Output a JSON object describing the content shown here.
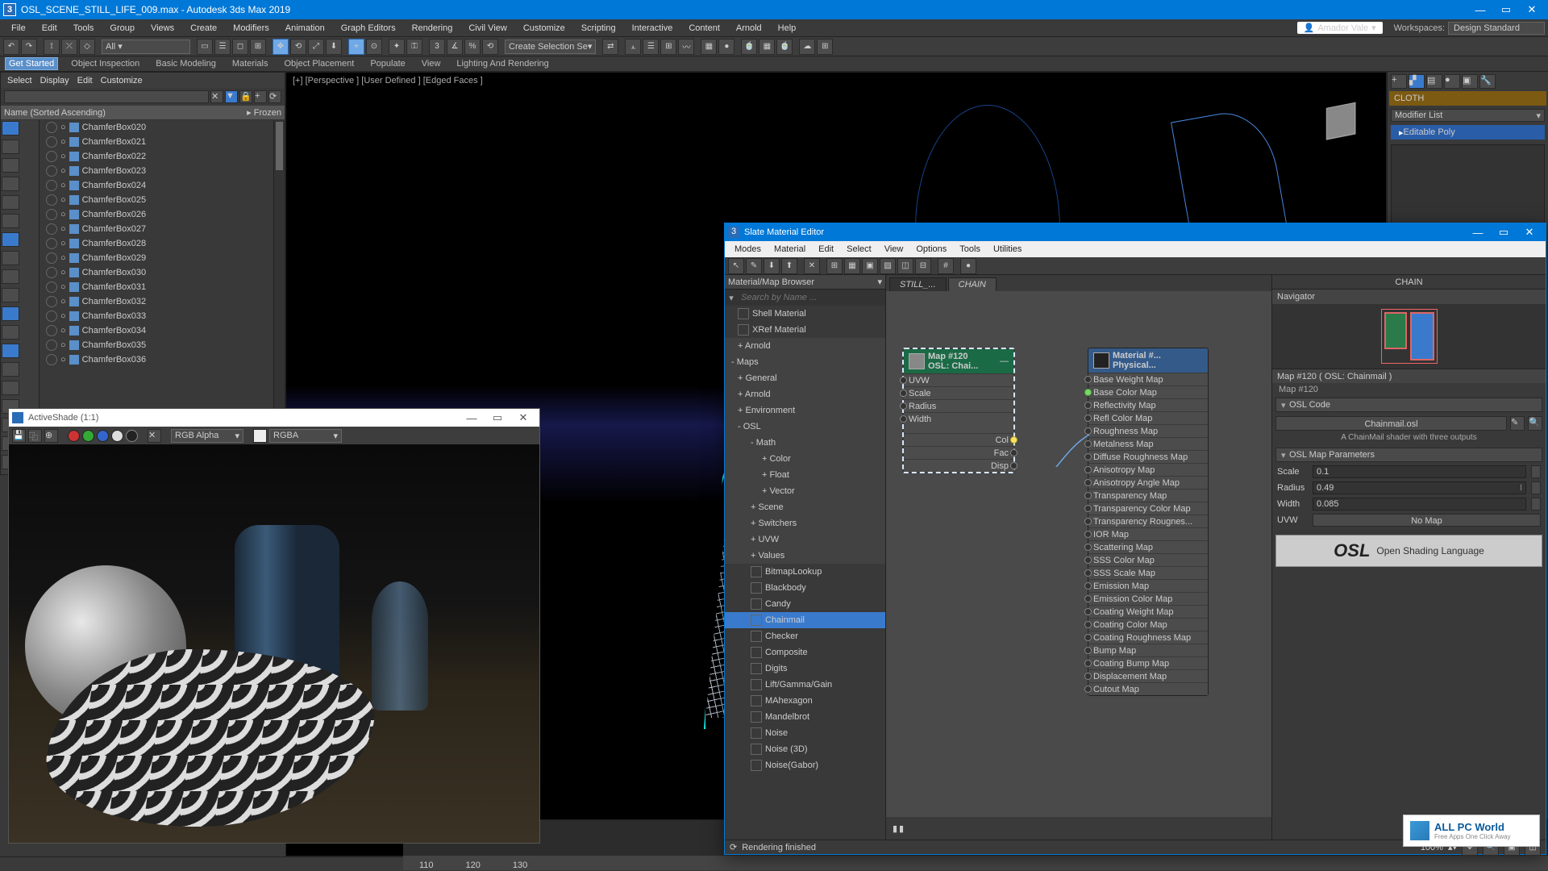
{
  "app": {
    "title": "OSL_SCENE_STILL_LIFE_009.max - Autodesk 3ds Max 2019",
    "user": "Amador Vale",
    "workspace_label": "Workspaces:",
    "workspace_value": "Design Standard"
  },
  "menus": [
    "File",
    "Edit",
    "Tools",
    "Group",
    "Views",
    "Create",
    "Modifiers",
    "Animation",
    "Graph Editors",
    "Rendering",
    "Civil View",
    "Customize",
    "Scripting",
    "Interactive",
    "Content",
    "Arnold",
    "Help"
  ],
  "selection_dropdown": "Create Selection Se",
  "ribbon": [
    "Get Started",
    "Object Inspection",
    "Basic Modeling",
    "Materials",
    "Object Placement",
    "Populate",
    "View",
    "Lighting And Rendering"
  ],
  "scene_explorer": {
    "menus": [
      "Select",
      "Display",
      "Edit",
      "Customize"
    ],
    "header_name": "Name (Sorted Ascending)",
    "header_frozen": "Frozen",
    "items": [
      "ChamferBox020",
      "ChamferBox021",
      "ChamferBox022",
      "ChamferBox023",
      "ChamferBox024",
      "ChamferBox025",
      "ChamferBox026",
      "ChamferBox027",
      "ChamferBox028",
      "ChamferBox029",
      "ChamferBox030",
      "ChamferBox031",
      "ChamferBox032",
      "ChamferBox033",
      "ChamferBox034",
      "ChamferBox035",
      "ChamferBox036"
    ]
  },
  "activeshade": {
    "title": "ActiveShade (1:1)",
    "channel": "RGB Alpha",
    "display": "RGBA"
  },
  "viewport": {
    "label": "[+] [Perspective ] [User Defined ] [Edged Faces ]"
  },
  "timeline": {
    "ticks": [
      "110",
      "120",
      "130"
    ]
  },
  "command_panel": {
    "stack_title": "CLOTH",
    "modlist": "Modifier List",
    "modifier": "Editable Poly"
  },
  "slate": {
    "title": "Slate Material Editor",
    "menus": [
      "Modes",
      "Material",
      "Edit",
      "Select",
      "View",
      "Options",
      "Tools",
      "Utilities"
    ],
    "browser_head": "Material/Map Browser",
    "search_placeholder": "Search by Name ...",
    "browser": [
      {
        "t": "Shell Material",
        "lvl": 1,
        "sw": true
      },
      {
        "t": "XRef Material",
        "lvl": 1,
        "sw": true
      },
      {
        "t": "+ Arnold",
        "lvl": 1,
        "hdr": true
      },
      {
        "t": "- Maps",
        "lvl": 0,
        "hdr": true
      },
      {
        "t": "+ General",
        "lvl": 1,
        "hdr": true
      },
      {
        "t": "+ Arnold",
        "lvl": 1,
        "hdr": true
      },
      {
        "t": "+ Environment",
        "lvl": 1,
        "hdr": true
      },
      {
        "t": "- OSL",
        "lvl": 1,
        "hdr": true
      },
      {
        "t": "- Math",
        "lvl": 2,
        "hdr": true
      },
      {
        "t": "+ Color",
        "lvl": 3,
        "hdr": true
      },
      {
        "t": "+ Float",
        "lvl": 3,
        "hdr": true
      },
      {
        "t": "+ Vector",
        "lvl": 3,
        "hdr": true
      },
      {
        "t": "+ Scene",
        "lvl": 2,
        "hdr": true
      },
      {
        "t": "+ Switchers",
        "lvl": 2,
        "hdr": true
      },
      {
        "t": "+ UVW",
        "lvl": 2,
        "hdr": true
      },
      {
        "t": "+ Values",
        "lvl": 2,
        "hdr": true
      },
      {
        "t": "BitmapLookup",
        "lvl": 2,
        "sw": true
      },
      {
        "t": "Blackbody",
        "lvl": 2,
        "sw": true
      },
      {
        "t": "Candy",
        "lvl": 2,
        "sw": true
      },
      {
        "t": "Chainmail",
        "lvl": 2,
        "sw": true,
        "sel": true
      },
      {
        "t": "Checker",
        "lvl": 2,
        "sw": true
      },
      {
        "t": "Composite",
        "lvl": 2,
        "sw": true
      },
      {
        "t": "Digits",
        "lvl": 2,
        "sw": true
      },
      {
        "t": "Lift/Gamma/Gain",
        "lvl": 2,
        "sw": true
      },
      {
        "t": "MAhexagon",
        "lvl": 2,
        "sw": true
      },
      {
        "t": "Mandelbrot",
        "lvl": 2,
        "sw": true
      },
      {
        "t": "Noise",
        "lvl": 2,
        "sw": true
      },
      {
        "t": "Noise (3D)",
        "lvl": 2,
        "sw": true
      },
      {
        "t": "Noise(Gabor)",
        "lvl": 2,
        "sw": true
      }
    ],
    "graph_tabs": [
      "STILL_...",
      "CHAIN"
    ],
    "right_tab": "CHAIN",
    "navigator": "Navigator",
    "map_node": {
      "title1": "Map #120",
      "title2": "OSL: Chai...",
      "ins": [
        "UVW",
        "Scale",
        "Radius",
        "Width"
      ],
      "outs": [
        "Col",
        "Fac",
        "Disp"
      ]
    },
    "mat_node": {
      "title1": "Material #...",
      "title2": "Physical...",
      "ins": [
        "Base Weight Map",
        "Base Color Map",
        "Reflectivity Map",
        "Refl Color Map",
        "Roughness Map",
        "Metalness Map",
        "Diffuse Roughness Map",
        "Anisotropy Map",
        "Anisotropy Angle Map",
        "Transparency Map",
        "Transparency Color Map",
        "Transparency Rougnes...",
        "IOR Map",
        "Scattering Map",
        "SSS Color Map",
        "SSS Scale Map",
        "Emission Map",
        "Emission Color Map",
        "Coating Weight Map",
        "Coating Color Map",
        "Coating Roughness Map",
        "Bump Map",
        "Coating Bump Map",
        "Displacement Map",
        "Cutout Map"
      ]
    },
    "param_title": "Map #120  ( OSL: Chainmail )",
    "param_sub": "Map #120",
    "rollout_osl": "OSL Code",
    "osl_filename": "Chainmail.osl",
    "osl_desc": "A ChainMail shader with three outputs",
    "rollout_params": "OSL Map Parameters",
    "params": {
      "Scale": "0.1",
      "Radius": "0.49",
      "Width": "0.085",
      "UVW_label": "UVW",
      "UVW_btn": "No Map"
    },
    "osl_badge_big": "OSL",
    "osl_badge_small": "Open Shading Language",
    "status": "Rendering finished"
  },
  "statusbar": {
    "zoom": "100%"
  },
  "watermark": {
    "t1": "ALL PC World",
    "t2": "Free Apps One Click Away"
  }
}
